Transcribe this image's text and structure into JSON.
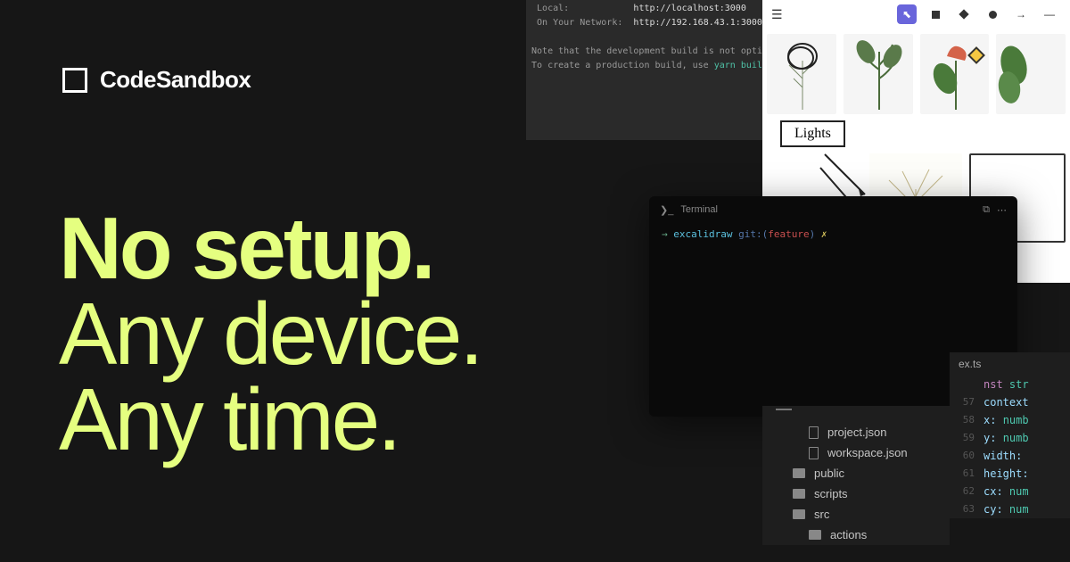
{
  "brand": {
    "name": "CodeSandbox"
  },
  "tagline": {
    "line1": "No setup.",
    "line2": "Any device.",
    "line3": "Any time."
  },
  "devServer": {
    "local_label": "  Local:",
    "local_url": "http://localhost:3000",
    "network_label": "  On Your Network:",
    "network_url": "http://192.168.43.1:3000",
    "note1": " Note that the development build is not opti",
    "note2_prefix": " To create a production build, use ",
    "note2_cmd": "yarn build"
  },
  "gallery": {
    "label": "Lights",
    "tools": {
      "cursor": "⬉",
      "arrow": "→",
      "line": "—"
    }
  },
  "terminal": {
    "title": "Terminal",
    "prompt": {
      "arrow": "→",
      "path": "excalidraw",
      "git_label": "git:(",
      "branch": "feature",
      "git_close": ")",
      "dirty": "✗"
    }
  },
  "explorer": {
    "items": [
      {
        "type": "file",
        "name": "project.json",
        "indent": true
      },
      {
        "type": "file",
        "name": "workspace.json",
        "indent": true
      },
      {
        "type": "folder",
        "name": "public",
        "indent": false
      },
      {
        "type": "folder",
        "name": "scripts",
        "indent": false
      },
      {
        "type": "folder",
        "name": "src",
        "indent": false
      },
      {
        "type": "folder",
        "name": "actions",
        "indent": true
      }
    ]
  },
  "editor": {
    "tab": "ex.ts",
    "lines": [
      {
        "n": "",
        "prop": "",
        "raw_const": "nst ",
        "raw_type": "str"
      },
      {
        "n": "57",
        "prop": "context"
      },
      {
        "n": "58",
        "prop": "x: ",
        "type": "numb"
      },
      {
        "n": "59",
        "prop": "y: ",
        "type": "numb"
      },
      {
        "n": "60",
        "prop": "width:"
      },
      {
        "n": "61",
        "prop": "height:"
      },
      {
        "n": "62",
        "prop": "cx: ",
        "type": "num"
      },
      {
        "n": "63",
        "prop": "cy: ",
        "type": "num"
      }
    ]
  }
}
